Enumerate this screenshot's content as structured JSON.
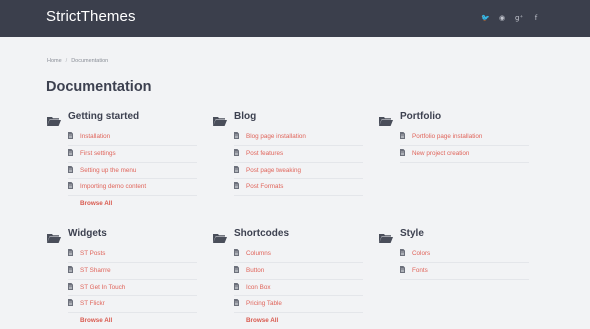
{
  "header": {
    "brand": "StrictThemes",
    "social": [
      {
        "icon": "twitter-icon",
        "glyph": "🐦"
      },
      {
        "icon": "rss-icon",
        "glyph": "◉"
      },
      {
        "icon": "google-plus-icon",
        "glyph": "g⁺"
      },
      {
        "icon": "facebook-icon",
        "glyph": "f"
      }
    ]
  },
  "breadcrumb": {
    "home": "Home",
    "sep": "/",
    "current": "Documentation"
  },
  "page_title": "Documentation",
  "sections": [
    {
      "key": "getting-started",
      "title": "Getting started",
      "items": [
        "Installation",
        "First settings",
        "Setting up the menu",
        "Importing demo content"
      ],
      "browse": "Browse All"
    },
    {
      "key": "blog",
      "title": "Blog",
      "items": [
        "Blog page installation",
        "Post features",
        "Post page tweaking",
        "Post Formats"
      ],
      "browse": ""
    },
    {
      "key": "portfolio",
      "title": "Portfolio",
      "items": [
        "Portfolio page installation",
        "New project creation"
      ],
      "browse": ""
    },
    {
      "key": "widgets",
      "title": "Widgets",
      "items": [
        "ST Posts",
        "ST Sharrre",
        "ST Get In Touch",
        "ST Flickr"
      ],
      "browse": "Browse All"
    },
    {
      "key": "shortcodes",
      "title": "Shortcodes",
      "items": [
        "Columns",
        "Button",
        "Icon Box",
        "Pricing Table"
      ],
      "browse": "Browse All"
    },
    {
      "key": "style",
      "title": "Style",
      "items": [
        "Colors",
        "Fonts"
      ],
      "browse": ""
    }
  ],
  "colors": {
    "header_bg": "#3b3f4c",
    "link": "#e0645a",
    "heading": "#3d4150"
  }
}
